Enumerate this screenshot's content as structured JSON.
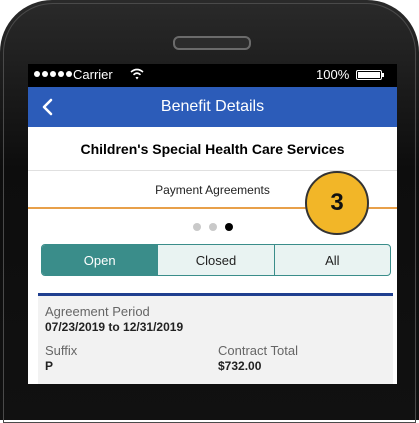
{
  "status_bar": {
    "carrier": "Carrier",
    "battery": "100%"
  },
  "nav": {
    "title": "Benefit Details"
  },
  "program": {
    "name": "Children's Special Health Care Services"
  },
  "section": {
    "title": "Payment Agreements"
  },
  "pager": {
    "page_count": 3,
    "active_page": 3
  },
  "tabs": [
    {
      "label": "Open",
      "selected": true
    },
    {
      "label": "Closed",
      "selected": false
    },
    {
      "label": "All",
      "selected": false
    }
  ],
  "agreement": {
    "period_label": "Agreement Period",
    "period_value": "07/23/2019 to 12/31/2019",
    "suffix_label": "Suffix",
    "suffix_value": "P",
    "contract_label": "Contract Total",
    "contract_value": "$732.00"
  },
  "callout": {
    "number": "3"
  },
  "colors": {
    "nav_blue": "#2c5cb9",
    "teal": "#3a8d8a",
    "orange_rule": "#e8a04a",
    "badge_yellow": "#f2b628",
    "card_rule": "#1f3f8f"
  }
}
